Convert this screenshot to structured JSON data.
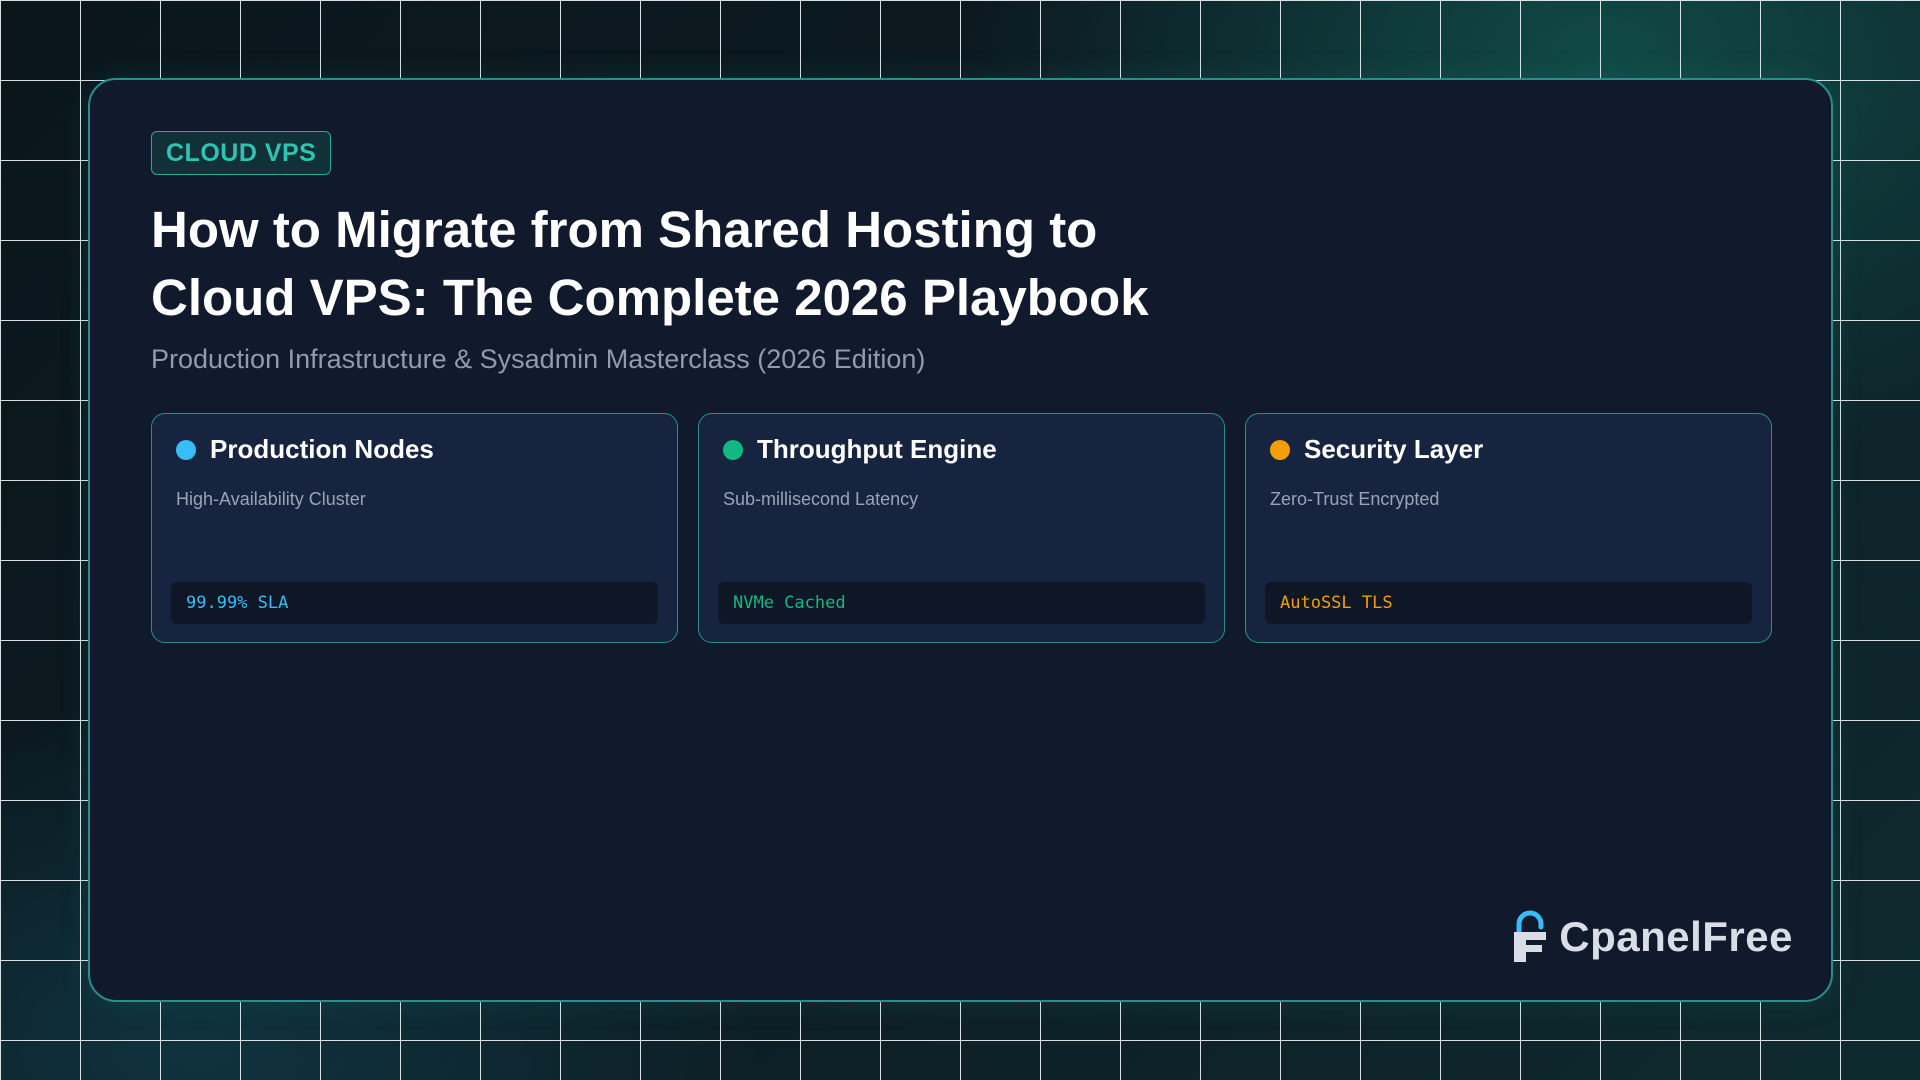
{
  "badge": "CLOUD VPS",
  "title": "How to Migrate from Shared Hosting to Cloud VPS: The Complete 2026 Playbook",
  "subtitle": "Production Infrastructure & Sysadmin Masterclass (2026 Edition)",
  "features": [
    {
      "title": "Production Nodes",
      "description": "High-Availability Cluster",
      "code": "99.99% SLA",
      "color": "#38bdf8",
      "icon": "dot-icon"
    },
    {
      "title": "Throughput Engine",
      "description": "Sub-millisecond Latency",
      "code": "NVMe Cached",
      "color": "#10b981",
      "icon": "dot-icon"
    },
    {
      "title": "Security Layer",
      "description": "Zero-Trust Encrypted",
      "code": "AutoSSL TLS",
      "color": "#f59e0b",
      "icon": "dot-icon"
    }
  ],
  "logo": {
    "text": "CpanelFree",
    "icon": "padlock-logo-icon"
  },
  "colors": {
    "accent": "#2fc4b2",
    "card_background": "#101a2c",
    "feature_background": "#172440"
  }
}
